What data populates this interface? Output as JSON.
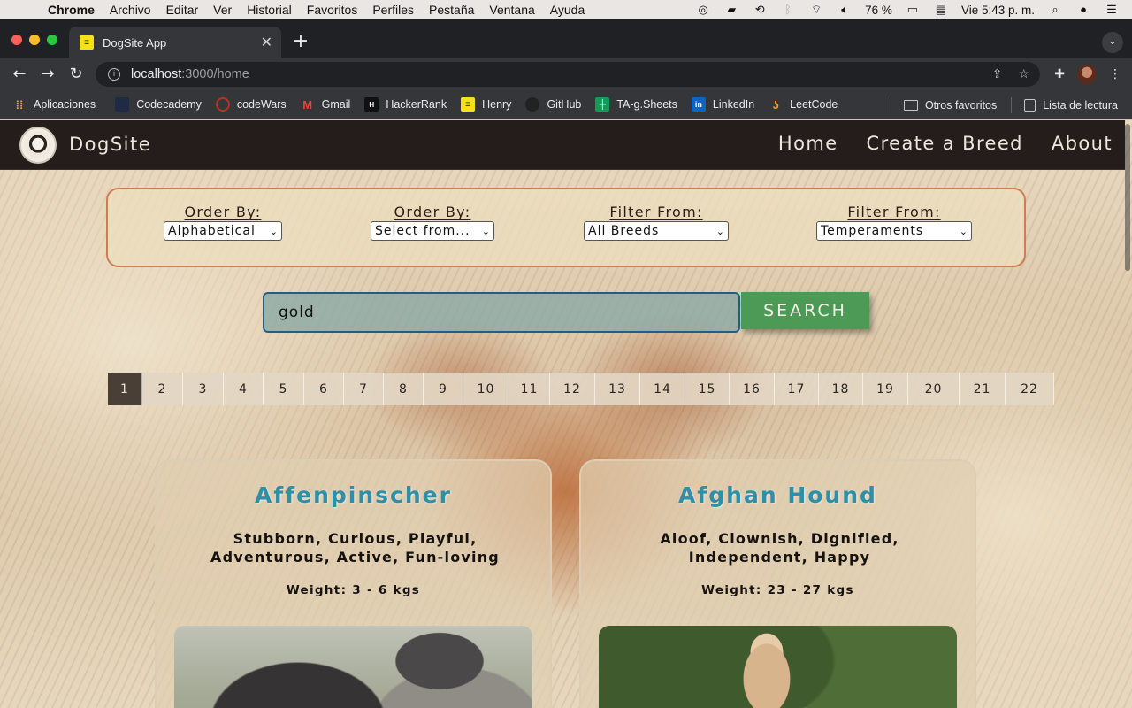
{
  "menubar": {
    "app": "Chrome",
    "items": [
      "Archivo",
      "Editar",
      "Ver",
      "Historial",
      "Favoritos",
      "Perfiles",
      "Pestaña",
      "Ventana",
      "Ayuda"
    ],
    "battery": "76 %",
    "clock": "Vie 5:43 p. m."
  },
  "browser": {
    "tab_title": "DogSite App",
    "url_host": "localhost",
    "url_rest": ":3000/home",
    "bookmarks": [
      {
        "label": "Aplicaciones",
        "icon": "apps-grid-icon"
      },
      {
        "label": "Codecademy",
        "icon": "codecademy-icon"
      },
      {
        "label": "codeWars",
        "icon": "codewars-icon"
      },
      {
        "label": "Gmail",
        "icon": "gmail-icon"
      },
      {
        "label": "HackerRank",
        "icon": "hackerrank-icon"
      },
      {
        "label": "Henry",
        "icon": "henry-icon"
      },
      {
        "label": "GitHub",
        "icon": "github-icon"
      },
      {
        "label": "TA-g.Sheets",
        "icon": "sheets-icon"
      },
      {
        "label": "LinkedIn",
        "icon": "linkedin-icon"
      },
      {
        "label": "LeetCode",
        "icon": "leetcode-icon"
      }
    ],
    "other_bookmarks": "Otros favoritos",
    "reading_list": "Lista de lectura"
  },
  "site": {
    "brand": "DogSite",
    "nav": {
      "home": "Home",
      "create": "Create a Breed",
      "about": "About"
    },
    "filters": [
      {
        "label": "Order By:",
        "value": "Alphabetical"
      },
      {
        "label": "Order By:",
        "value": "Select from..."
      },
      {
        "label": "Filter From:",
        "value": "All Breeds"
      },
      {
        "label": "Filter From:",
        "value": "Temperaments"
      }
    ],
    "search": {
      "value": "gold",
      "button": "SEARCH"
    },
    "pages": [
      "1",
      "2",
      "3",
      "4",
      "5",
      "6",
      "7",
      "8",
      "9",
      "10",
      "11",
      "12",
      "13",
      "14",
      "15",
      "16",
      "17",
      "18",
      "19",
      "20",
      "21",
      "22"
    ],
    "current_page": "1",
    "cards": [
      {
        "name": "Affenpinscher",
        "temperament": "Stubborn, Curious, Playful, Adventurous, Active, Fun-loving",
        "weight": "Weight: 3 - 6 kgs"
      },
      {
        "name": "Afghan Hound",
        "temperament": "Aloof, Clownish, Dignified, Independent, Happy",
        "weight": "Weight: 23 - 27 kgs"
      }
    ]
  },
  "colors": {
    "accent_title": "#2e8fa6",
    "search_button": "#4d9a57",
    "filter_border": "#d07c52",
    "navbar": "#241d1b"
  }
}
